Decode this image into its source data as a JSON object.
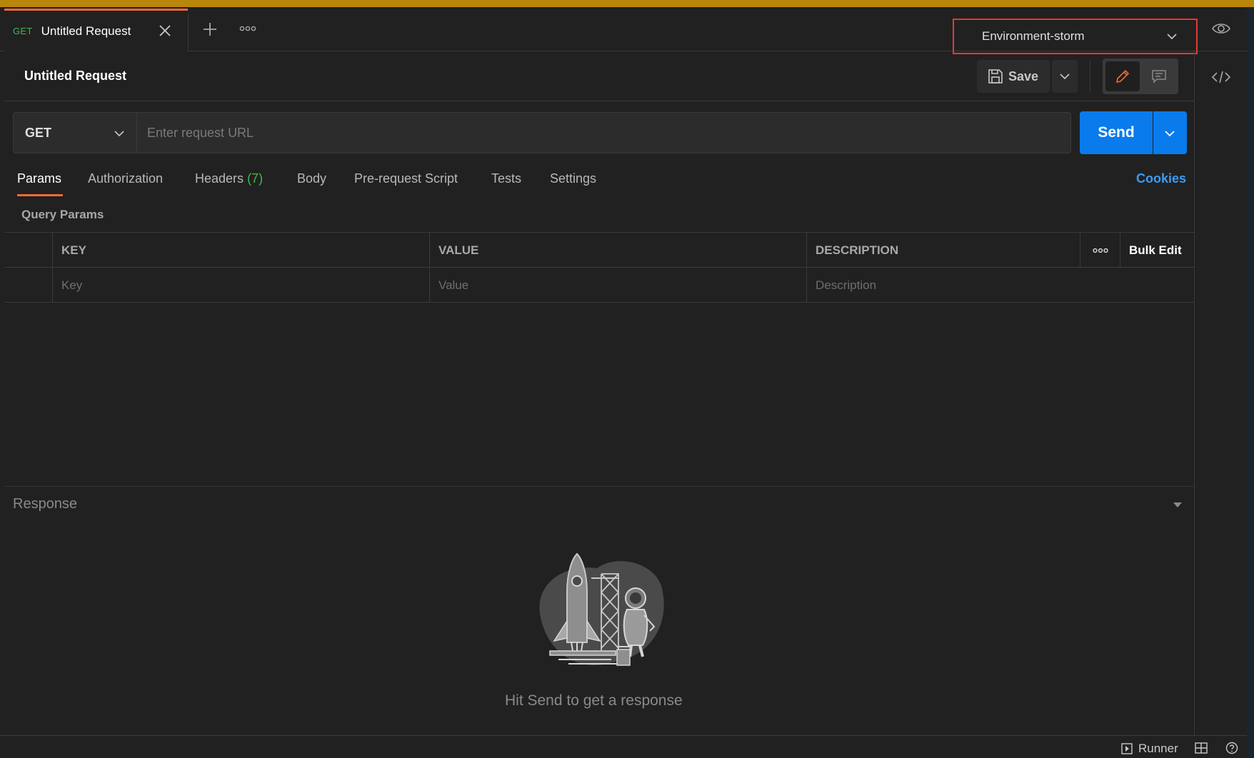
{
  "tab": {
    "method": "GET",
    "title": "Untitled Request"
  },
  "environment": {
    "selected": "Environment-storm"
  },
  "request": {
    "title": "Untitled Request",
    "save_label": "Save",
    "method": "GET",
    "url_placeholder": "Enter request URL",
    "url_value": "",
    "send_label": "Send"
  },
  "request_tabs": {
    "params": "Params",
    "authorization": "Authorization",
    "headers": "Headers",
    "headers_count": "(7)",
    "body": "Body",
    "prerequest": "Pre-request Script",
    "tests": "Tests",
    "settings": "Settings",
    "cookies": "Cookies"
  },
  "query_params": {
    "label": "Query Params",
    "columns": [
      "KEY",
      "VALUE",
      "DESCRIPTION"
    ],
    "bulk_edit": "Bulk Edit",
    "placeholders": [
      "Key",
      "Value",
      "Description"
    ]
  },
  "response": {
    "label": "Response",
    "empty_message": "Hit Send to get a response"
  },
  "status_bar": {
    "runner": "Runner"
  },
  "colors": {
    "accent": "#f26b3a",
    "send_blue": "#097bed",
    "method_green": "#3fb950",
    "link_blue": "#3d9bf5",
    "highlight_red": "#e53935"
  }
}
